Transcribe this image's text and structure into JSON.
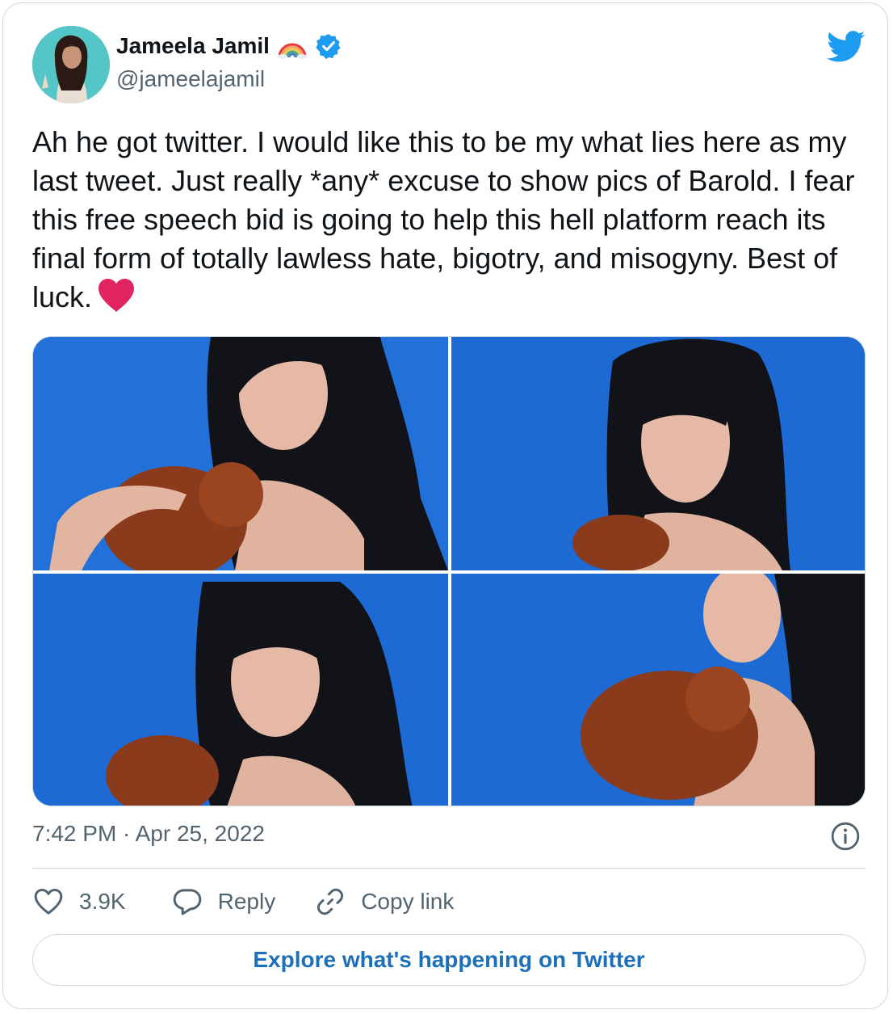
{
  "author": {
    "name": "Jameela Jamil",
    "handle": "@jameelajamil",
    "verified": true
  },
  "tweet": {
    "text": "Ah he got twitter. I would like this to be my what lies here as my last tweet. Just really *any* excuse to show pics of Barold. I fear this free speech bid is going to help this hell platform reach its final form of totally lawless hate, bigotry, and misogyny. Best of luck.",
    "timestamp": "7:42 PM · Apr 25, 2022"
  },
  "actions": {
    "like_count": "3.9K",
    "reply_label": "Reply",
    "copy_link_label": "Copy link"
  },
  "explore_label": "Explore what's happening on Twitter",
  "colors": {
    "twitter_blue": "#1d9bf0",
    "text_primary": "#0f1419",
    "text_secondary": "#536471",
    "border": "#cfd9de",
    "heart_red": "#e0245e"
  },
  "icons": [
    "avatar-photo",
    "rainbow-icon",
    "verified-badge-icon",
    "twitter-bird-icon",
    "heart-emoji-icon",
    "info-icon",
    "like-heart-icon",
    "reply-bubble-icon",
    "copy-link-icon"
  ]
}
